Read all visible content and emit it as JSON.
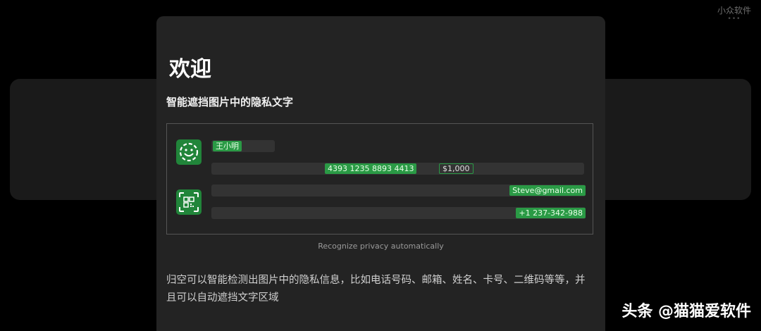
{
  "watermark_top": {
    "text": "小众软件",
    "dots": "•••"
  },
  "modal": {
    "title": "欢迎",
    "subtitle": "智能遮挡图片中的隐私文字",
    "demo": {
      "name": "王小明",
      "card_number": "4393 1235 8893 4413",
      "amount": "$1,000",
      "email": "Steve@gmail.com",
      "phone": "+1 237-342-988"
    },
    "caption": "Recognize privacy automatically",
    "description": "归空可以智能检测出图片中的隐私信息，比如电话号码、邮箱、姓名、卡号、二维码等等，并且可以自动遮挡文字区域"
  },
  "watermark_bottom": {
    "text": "头条 @猫猫爱软件"
  },
  "colors": {
    "accent_green": "#2a9a45",
    "icon_green": "#21853a",
    "modal_bg": "#232323",
    "page_bg": "#000000"
  },
  "icons": [
    "smiley-face-icon",
    "qr-code-icon"
  ]
}
